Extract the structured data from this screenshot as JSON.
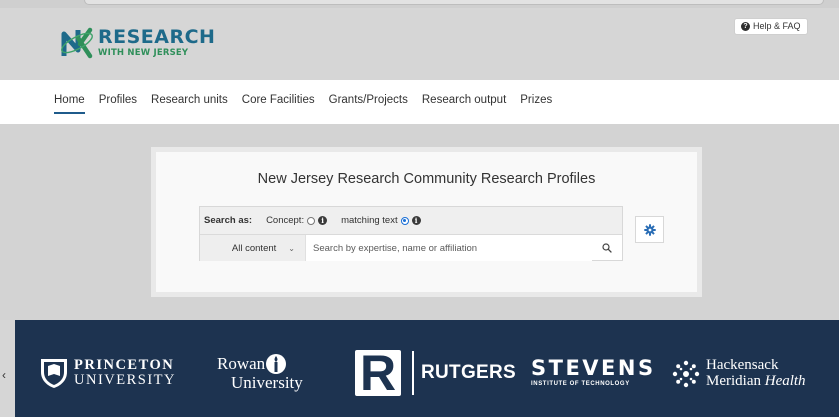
{
  "header": {
    "logo": {
      "line1": "RESEARCH",
      "line2": "WITH NEW JERSEY"
    },
    "help_label": "Help & FAQ"
  },
  "nav": {
    "items": [
      {
        "label": "Home",
        "active": true
      },
      {
        "label": "Profiles"
      },
      {
        "label": "Research units"
      },
      {
        "label": "Core Facilities"
      },
      {
        "label": "Grants/Projects"
      },
      {
        "label": "Research output"
      },
      {
        "label": "Prizes"
      }
    ]
  },
  "search": {
    "title": "New Jersey Research Community Research Profiles",
    "search_as_label": "Search as:",
    "concept_label": "Concept:",
    "matching_text_label": "matching text",
    "selected_mode": "matching text",
    "scope_value": "All content",
    "placeholder": "Search by expertise, name or affiliation"
  },
  "partners": {
    "princeton": {
      "line1": "PRINCETON",
      "line2": "UNIVERSITY"
    },
    "rowan": {
      "line1": "Rowan",
      "line2": "University"
    },
    "rutgers": {
      "mark": "R",
      "name": "RUTGERS"
    },
    "stevens": {
      "line1": "STEVENS",
      "line2": "INSTITUTE OF TECHNOLOGY"
    },
    "hackensack": {
      "line1": "Hackensack",
      "line2a": "Meridian ",
      "line2b": "Health"
    }
  },
  "colors": {
    "footer_bg": "#1d3350",
    "logo_blue": "#1e6a8a",
    "logo_green": "#2f8f5a",
    "nav_active_underline": "#1f5b8b",
    "radio_selected": "#1a6fd6",
    "gear_icon": "#2a6db5"
  },
  "icons": {
    "logo": "nj-logo-icon",
    "help": "help-circle-icon",
    "info": "info-icon",
    "chevron": "chevron-down-icon",
    "search": "search-icon",
    "settings": "gear-icon"
  }
}
